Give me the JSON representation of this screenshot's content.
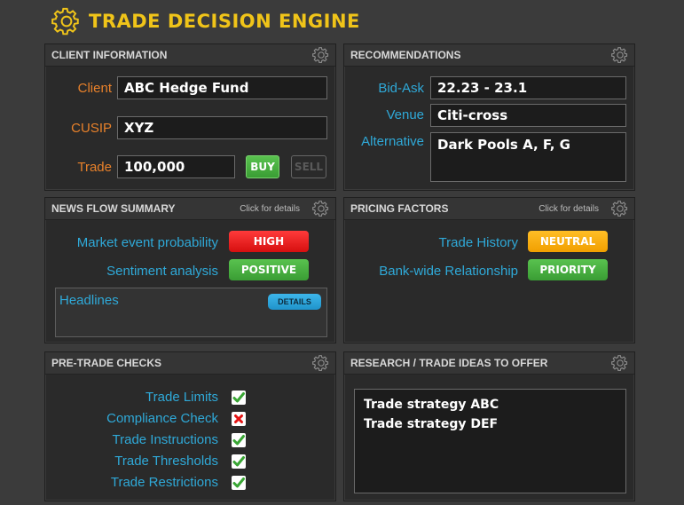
{
  "app": {
    "title": "TRADE DECISION ENGINE"
  },
  "colors": {
    "accent": "#f0c419",
    "label_orange": "#e8812a",
    "label_blue": "#2fa9d8",
    "high": "#e31414",
    "positive": "#43a83b",
    "neutral": "#f5a800"
  },
  "client_info": {
    "title": "CLIENT INFORMATION",
    "client_label": "Client",
    "client_value": "ABC Hedge Fund",
    "cusip_label": "CUSIP",
    "cusip_value": "XYZ",
    "trade_label": "Trade",
    "trade_value": "100,000",
    "buy_label": "BUY",
    "sell_label": "SELL"
  },
  "recommendations": {
    "title": "RECOMMENDATIONS",
    "bid_ask_label": "Bid-Ask",
    "bid_ask_value": "22.23 - 23.1",
    "venue_label": "Venue",
    "venue_value": "Citi-cross",
    "alternative_label": "Alternative",
    "alternative_value": "Dark Pools A, F, G"
  },
  "news_flow": {
    "title": "NEWS FLOW SUMMARY",
    "hint": "Click for details",
    "market_event_label": "Market event probability",
    "market_event_value": "HIGH",
    "sentiment_label": "Sentiment analysis",
    "sentiment_value": "POSITIVE",
    "headlines_label": "Headlines",
    "details_label": "DETAILS"
  },
  "pricing_factors": {
    "title": "PRICING FACTORS",
    "hint": "Click for details",
    "trade_history_label": "Trade History",
    "trade_history_value": "NEUTRAL",
    "relationship_label": "Bank-wide Relationship",
    "relationship_value": "PRIORITY"
  },
  "pre_trade_checks": {
    "title": "PRE-TRADE CHECKS",
    "items": [
      {
        "label": "Trade Limits",
        "status": "pass"
      },
      {
        "label": "Compliance Check",
        "status": "fail"
      },
      {
        "label": "Trade Instructions",
        "status": "pass"
      },
      {
        "label": "Trade Thresholds",
        "status": "pass"
      },
      {
        "label": "Trade Restrictions",
        "status": "pass"
      }
    ]
  },
  "research": {
    "title": "RESEARCH / TRADE IDEAS TO OFFER",
    "items": [
      "Trade strategy ABC",
      "Trade strategy DEF"
    ]
  },
  "icons": {
    "logo": "gear-icon",
    "panel_settings": "gear-icon",
    "pass": "check-icon",
    "fail": "x-icon"
  }
}
